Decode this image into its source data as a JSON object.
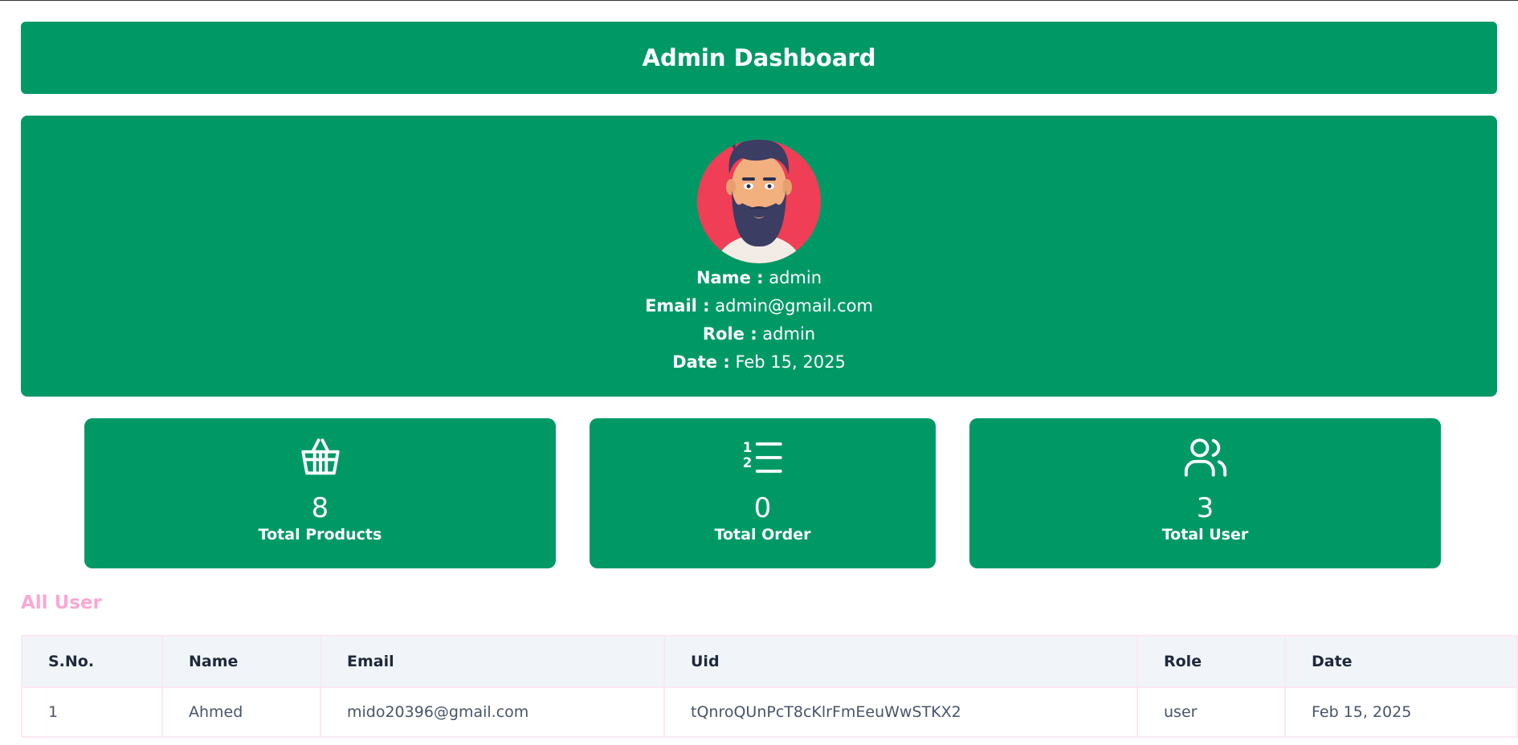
{
  "header": {
    "title": "Admin Dashboard"
  },
  "profile": {
    "name_label": "Name :",
    "name_value": "admin",
    "email_label": "Email :",
    "email_value": "admin@gmail.com",
    "role_label": "Role :",
    "role_value": "admin",
    "date_label": "Date :",
    "date_value": "Feb 15, 2025"
  },
  "stats": [
    {
      "icon": "basket-icon",
      "value": "8",
      "label": "Total Products"
    },
    {
      "icon": "numbered-list-icon",
      "value": "0",
      "label": "Total Order"
    },
    {
      "icon": "users-icon",
      "value": "3",
      "label": "Total User"
    }
  ],
  "users_section": {
    "title": "All User",
    "columns": [
      "S.No.",
      "Name",
      "Email",
      "Uid",
      "Role",
      "Date"
    ],
    "rows": [
      [
        "1",
        "Ahmed",
        "mido20396@gmail.com",
        "tQnroQUnPcT8cKlrFmEeuWwSTKX2",
        "user",
        "Feb 15, 2025"
      ]
    ]
  },
  "colors": {
    "primary": "#009966",
    "accent_pink": "#f9a8d4",
    "avatar_bg": "#ef3e56"
  }
}
